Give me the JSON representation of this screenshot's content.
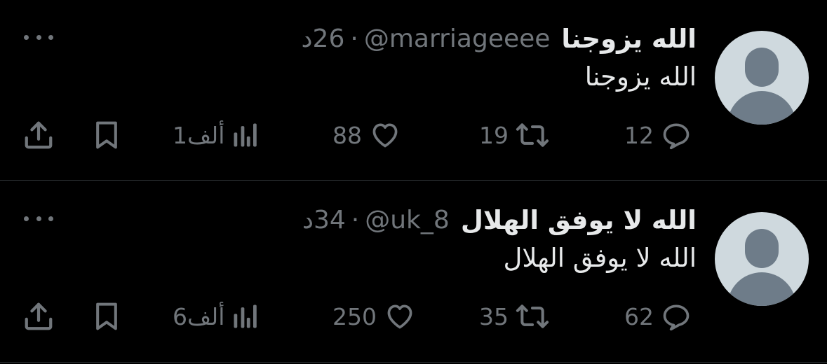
{
  "tweets": [
    {
      "display_name": "الله يزوجنا",
      "handle": "@marriageeee",
      "separator": "·",
      "time_value": "26",
      "time_unit": "د",
      "text": "الله يزوجنا",
      "replies": "12",
      "retweets": "19",
      "likes": "88",
      "views": "1ألف"
    },
    {
      "display_name": "الله لا يوفق الهلال",
      "handle": "@uk_8",
      "separator": "·",
      "time_value": "34",
      "time_unit": "د",
      "text": "الله لا يوفق الهلال",
      "replies": "62",
      "retweets": "35",
      "likes": "250",
      "views": "6ألف"
    }
  ],
  "icons": {
    "more": "more-horizontal-icon",
    "reply": "reply-bubble-icon",
    "retweet": "retweet-icon",
    "like": "heart-icon",
    "views": "views-bar-chart-icon",
    "bookmark": "bookmark-icon",
    "share": "share-upload-icon"
  },
  "colors": {
    "background": "#000000",
    "primary_text": "#e7e9ea",
    "secondary_text": "#71767b",
    "divider": "#2f3336",
    "avatar_bg": "#cfd9de",
    "avatar_fg": "#6e7c89"
  }
}
